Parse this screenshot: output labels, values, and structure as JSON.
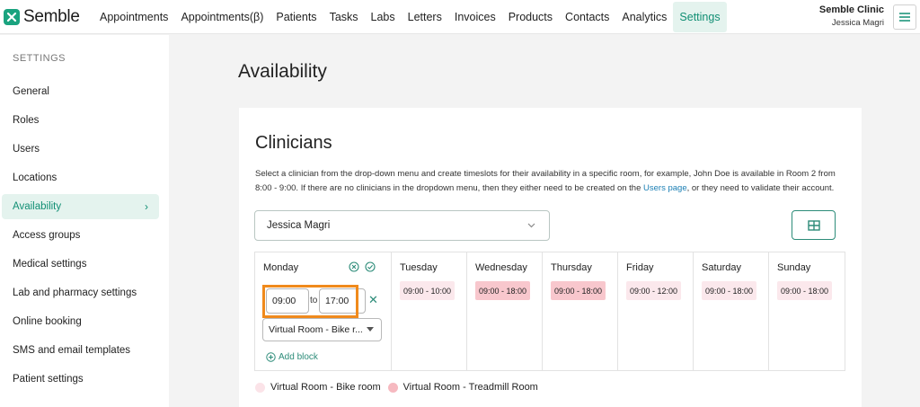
{
  "app": {
    "name": "Semble"
  },
  "nav": {
    "items": [
      "Appointments",
      "Appointments(β)",
      "Patients",
      "Tasks",
      "Labs",
      "Letters",
      "Invoices",
      "Products",
      "Contacts",
      "Analytics",
      "Settings"
    ],
    "active": "Settings"
  },
  "account": {
    "clinic": "Semble Clinic",
    "user": "Jessica Magri"
  },
  "sidebar": {
    "heading": "SETTINGS",
    "items": [
      "General",
      "Roles",
      "Users",
      "Locations",
      "Availability",
      "Access groups",
      "Medical settings",
      "Lab and pharmacy settings",
      "Online booking",
      "SMS and email templates",
      "Patient settings"
    ],
    "active": "Availability"
  },
  "page": {
    "title": "Availability"
  },
  "clinicians": {
    "title": "Clinicians",
    "desc_part1": "Select a clinician from the drop-down menu and create timeslots for their availability in a specific room, for example, John Doe is available in Room 2 from 8:00 - 9:00. If there are no clinicians in the dropdown menu, then they either need to be created on the ",
    "desc_link": "Users page",
    "desc_part2": ", or they need to validate their account.",
    "selected_clinician": "Jessica Magri"
  },
  "week": {
    "monday": {
      "name": "Monday",
      "start": "09:00",
      "to": "to",
      "end": "17:00",
      "room": "Virtual Room - Bike r...",
      "add_block": "Add block"
    },
    "days": [
      {
        "name": "Tuesday",
        "slot": "09:00 - 10:00",
        "room": "bike"
      },
      {
        "name": "Wednesday",
        "slot": "09:00 - 18:00",
        "room": "tread"
      },
      {
        "name": "Thursday",
        "slot": "09:00 - 18:00",
        "room": "tread"
      },
      {
        "name": "Friday",
        "slot": "09:00 - 12:00",
        "room": "bike"
      },
      {
        "name": "Saturday",
        "slot": "09:00 - 18:00",
        "room": "bike"
      },
      {
        "name": "Sunday",
        "slot": "09:00 - 18:00",
        "room": "bike"
      }
    ]
  },
  "legend": [
    {
      "label": "Virtual Room - Bike room",
      "color": "#fbe3e8"
    },
    {
      "label": "Virtual Room - Treadmill Room",
      "color": "#f6b9c0"
    }
  ],
  "colors": {
    "accent": "#118f74",
    "highlight": "#f08a1c"
  }
}
